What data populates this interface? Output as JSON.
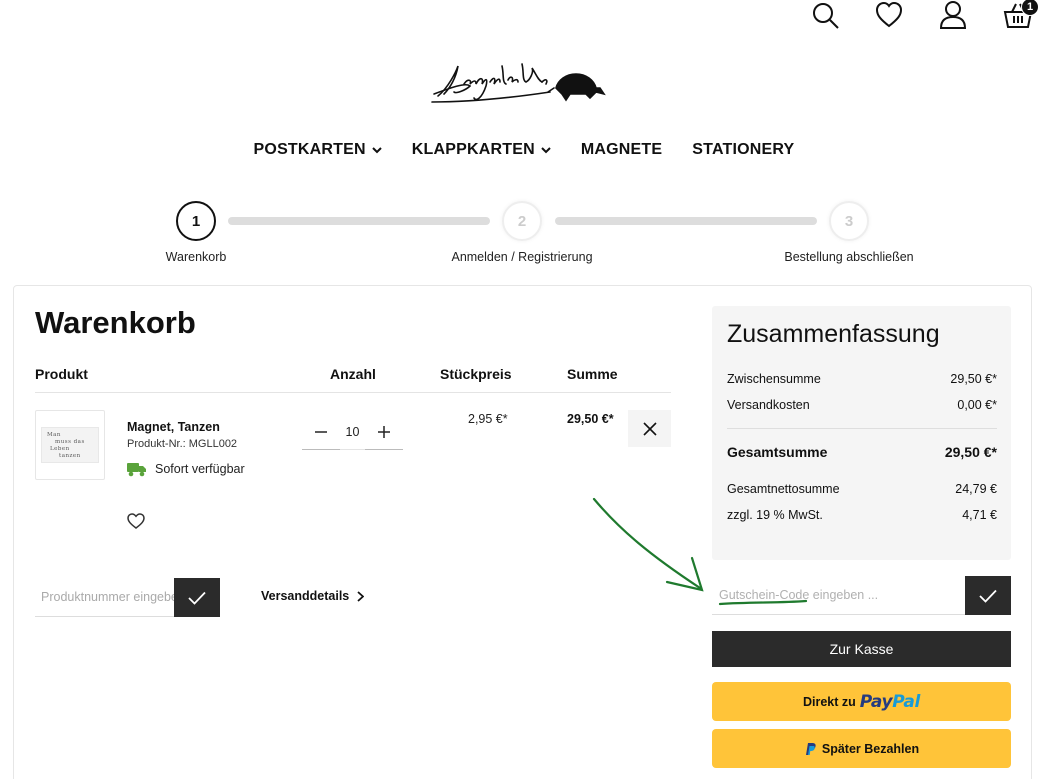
{
  "header": {
    "cart_count": "1",
    "logo_alt": "Langelütje"
  },
  "nav": {
    "items": [
      {
        "label": "POSTKARTEN"
      },
      {
        "label": "KLAPPKARTEN"
      },
      {
        "label": "MAGNETE"
      },
      {
        "label": "STATIONERY"
      }
    ]
  },
  "stepper": {
    "steps": [
      {
        "number": "1",
        "label": "Warenkorb"
      },
      {
        "number": "2",
        "label": "Anmelden / Registrierung"
      },
      {
        "number": "3",
        "label": "Bestellung abschließen"
      }
    ]
  },
  "cart": {
    "title": "Warenkorb",
    "columns": {
      "product": "Produkt",
      "quantity": "Anzahl",
      "unit_price": "Stückpreis",
      "total": "Summe"
    },
    "items": [
      {
        "name": "Magnet, Tanzen",
        "number": "Produkt-Nr.: MGLL002",
        "availability": "Sofort verfügbar",
        "quantity": "10",
        "unit_price": "2,95 €*",
        "total": "29,50 €*",
        "image_text": [
          "Man",
          "muss das",
          "Leben",
          "tanzen"
        ]
      }
    ],
    "product_number_placeholder": "Produktnummer eingeben ...",
    "shipping_link": "Versanddetails"
  },
  "summary": {
    "title": "Zusammenfassung",
    "subtotal_label": "Zwischensumme",
    "subtotal": "29,50 €*",
    "shipping_label": "Versandkosten",
    "shipping": "0,00 €*",
    "grand_total_label": "Gesamtsumme",
    "grand_total": "29,50 €*",
    "net_label": "Gesamtnettosumme",
    "net": "24,79 €",
    "vat_label": "zzgl. 19 % MwSt.",
    "vat": "4,71 €",
    "coupon_placeholder": "Gutschein-Code eingeben ...",
    "checkout_label": "Zur Kasse",
    "paypal_direct_prefix": "Direkt zu",
    "paypal_logo_1": "Pay",
    "paypal_logo_2": "Pal",
    "paypal_later_label": "Später Bezahlen"
  },
  "colors": {
    "dark_button": "#2b2b2b",
    "paypal_yellow": "#ffc439",
    "availability_green": "#5aa33b",
    "annotation_green": "#1f7a2e"
  }
}
